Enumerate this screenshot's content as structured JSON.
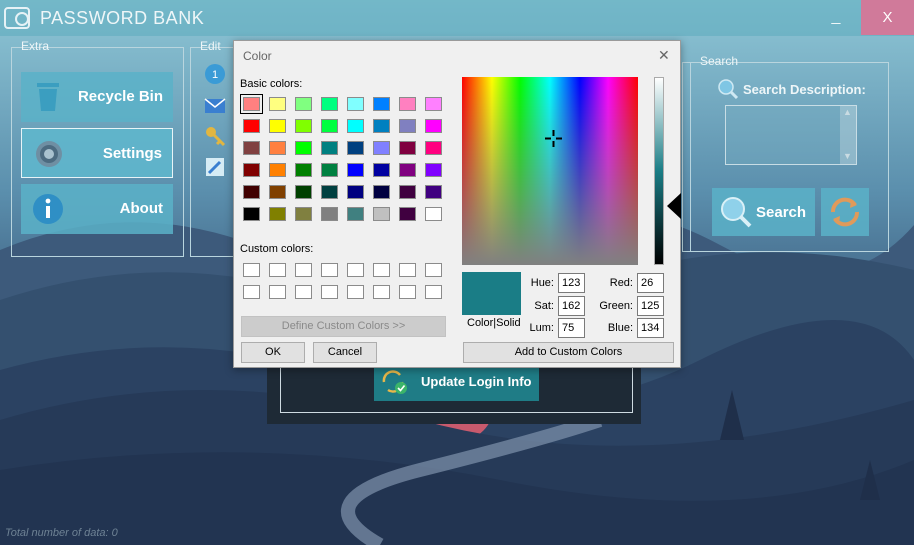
{
  "app": {
    "title": "PASSWORD BANK",
    "minimize_label": "_",
    "close_label": "X"
  },
  "extra": {
    "title": "Extra",
    "buttons": [
      {
        "label": "Recycle Bin",
        "icon": "trash-icon"
      },
      {
        "label": "Settings",
        "icon": "gear-icon"
      },
      {
        "label": "About",
        "icon": "info-icon"
      }
    ]
  },
  "edit": {
    "title": "Edit",
    "icons": [
      "number-one-icon",
      "mail-icon",
      "key-icon",
      "pencil-icon"
    ]
  },
  "search": {
    "title": "Search",
    "description_label": "Search Description:",
    "input_value": "",
    "button_label": "Search"
  },
  "update": {
    "button_label": "Update Login Info"
  },
  "footer": {
    "total_label": "Total number of data: 0"
  },
  "color_dialog": {
    "title": "Color",
    "close_glyph": "✕",
    "basic_colors_label": "Basic colors:",
    "custom_colors_label": "Custom colors:",
    "basic_colors": [
      "#ff8080",
      "#ffff80",
      "#80ff80",
      "#00ff80",
      "#80ffff",
      "#0080ff",
      "#ff80c0",
      "#ff80ff",
      "#ff0000",
      "#ffff00",
      "#80ff00",
      "#00ff40",
      "#00ffff",
      "#0080c0",
      "#8080c0",
      "#ff00ff",
      "#804040",
      "#ff8040",
      "#00ff00",
      "#008080",
      "#004080",
      "#8080ff",
      "#800040",
      "#ff0080",
      "#800000",
      "#ff8000",
      "#008000",
      "#008040",
      "#0000ff",
      "#0000a0",
      "#800080",
      "#8000ff",
      "#400000",
      "#804000",
      "#004000",
      "#004040",
      "#000080",
      "#000040",
      "#400040",
      "#400080",
      "#000000",
      "#808000",
      "#808040",
      "#808080",
      "#408080",
      "#c0c0c0",
      "#400040",
      "#ffffff"
    ],
    "selected_index": 0,
    "custom_colors": [
      "#ffffff",
      "#ffffff",
      "#ffffff",
      "#ffffff",
      "#ffffff",
      "#ffffff",
      "#ffffff",
      "#ffffff",
      "#ffffff",
      "#ffffff",
      "#ffffff",
      "#ffffff",
      "#ffffff",
      "#ffffff",
      "#ffffff",
      "#ffffff"
    ],
    "define_custom_label": "Define Custom Colors >>",
    "ok_label": "OK",
    "cancel_label": "Cancel",
    "add_custom_label": "Add to Custom Colors",
    "color_solid_label": "Color|Solid",
    "preview_color": "#1a7d86",
    "hue_label": "Hue:",
    "hue_value": "123",
    "sat_label": "Sat:",
    "sat_value": "162",
    "lum_label": "Lum:",
    "lum_value": "75",
    "red_label": "Red:",
    "red_value": "26",
    "green_label": "Green:",
    "green_value": "125",
    "blue_label": "Blue:",
    "blue_value": "134"
  },
  "colors": {
    "accent": "#5ab2c8",
    "close_button": "#d07a9a",
    "update_button": "#1f7c86"
  }
}
